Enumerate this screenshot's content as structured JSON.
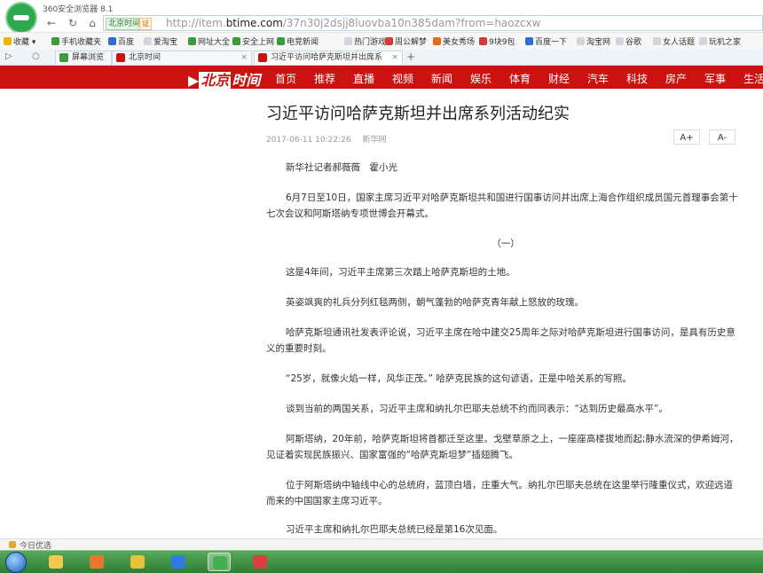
{
  "browser": {
    "title": "360安全浏览器 8.1",
    "site_badge": "北京时间",
    "cert_badge": "证",
    "url_prefix": "http://item.",
    "url_domain": "btime.com",
    "url_rest": "/37n30j2dsjj8luovba10n385dam?from=haozcxw"
  },
  "favorites": [
    {
      "label": "收藏 ▾",
      "color": "#f0b400"
    },
    {
      "label": "手机收藏夹",
      "color": "#3a9c3a"
    },
    {
      "label": "百度",
      "color": "#2f6fd0"
    },
    {
      "label": "爱淘宝",
      "color": "#cfd6de"
    },
    {
      "label": "网址大全",
      "color": "#3a9c3a"
    },
    {
      "label": "安全上网",
      "color": "#3a9c3a"
    },
    {
      "label": "电竞新闻",
      "color": "#3a9c3a"
    },
    {
      "label": "热门游戏",
      "color": "#cfd6de"
    },
    {
      "label": "周公解梦",
      "color": "#d83a3a"
    },
    {
      "label": "美女秀场",
      "color": "#e86a1a"
    },
    {
      "label": "9块9包",
      "color": "#d83a3a"
    },
    {
      "label": "百度一下",
      "color": "#2f6fd0"
    },
    {
      "label": "淘宝网",
      "color": "#cfd6de"
    },
    {
      "label": "谷歌",
      "color": "#cfd6de"
    },
    {
      "label": "女人话题",
      "color": "#cfd6de"
    },
    {
      "label": "玩机之家",
      "color": "#cfd6de"
    }
  ],
  "tabs": [
    {
      "label": "屏幕浏览",
      "color": "#3a9c3a"
    },
    {
      "label": "北京时间",
      "color": "#cc1111"
    },
    {
      "label": "习近平访问哈萨克斯坦并出席系",
      "color": "#cc1111"
    }
  ],
  "site": {
    "logo_bj": "北京",
    "logo_rest": "时间",
    "nav": [
      "首页",
      "推荐",
      "直播",
      "视频",
      "新闻",
      "娱乐",
      "体育",
      "财经",
      "汽车",
      "科技",
      "房产",
      "军事",
      "生活"
    ]
  },
  "article": {
    "title": "习近平访问哈萨克斯坦并出席系列活动纪实",
    "date": "2017-06-11 10:22:26",
    "source": "新华网",
    "font_up": "A+",
    "font_down": "A-",
    "byline": "新华社记者郝薇薇　霍小光",
    "paragraphs": [
      "6月7日至10日，国家主席习近平对哈萨克斯坦共和国进行国事访问并出席上海合作组织成员国元首理事会第十七次会议和阿斯塔纳专项世博会开幕式。",
      "（一）",
      "这是4年间，习近平主席第三次踏上哈萨克斯坦的土地。",
      "英姿飒爽的礼兵分列红毯两侧，朝气蓬勃的哈萨克青年献上怒放的玫瑰。",
      "哈萨克斯坦通讯社发表评论说，习近平主席在哈中建交25周年之际对哈萨克斯坦进行国事访问，是具有历史意义的重要时刻。",
      "“25岁，就像火焰一样，风华正茂。” 哈萨克民族的这句谚语，正是中哈关系的写照。",
      "谈到当前的两国关系，习近平主席和纳扎尔巴耶夫总统不约而同表示：“达到历史最高水平”。",
      "阿斯塔纳，20年前，哈萨克斯坦将首都迁至这里。戈壁草原之上，一座座高楼拔地而起;静水流深的伊希姆河，见证着实现民族振兴、国家富强的“哈萨克斯坦梦”插翅腾飞。",
      "位于阿斯塔纳中轴线中心的总统府，蓝顶白墙，庄重大气。纳扎尔巴耶夫总统在这里举行隆重仪式，欢迎远道而来的中国国家主席习近平。",
      "习近平主席和纳扎尔巴耶夫总统已经是第16次见面。"
    ]
  },
  "status": {
    "label": "今日优选"
  },
  "taskbar": [
    {
      "name": "folder-icon",
      "color": "#f2c94c"
    },
    {
      "name": "game-icon",
      "color": "#e8772e"
    },
    {
      "name": "paint-icon",
      "color": "#e8c33a"
    },
    {
      "name": "kugou-icon",
      "color": "#2b7de0"
    },
    {
      "name": "browser-360-icon",
      "color": "#3fb24f"
    },
    {
      "name": "screenshot-icon",
      "color": "#d84040"
    }
  ]
}
